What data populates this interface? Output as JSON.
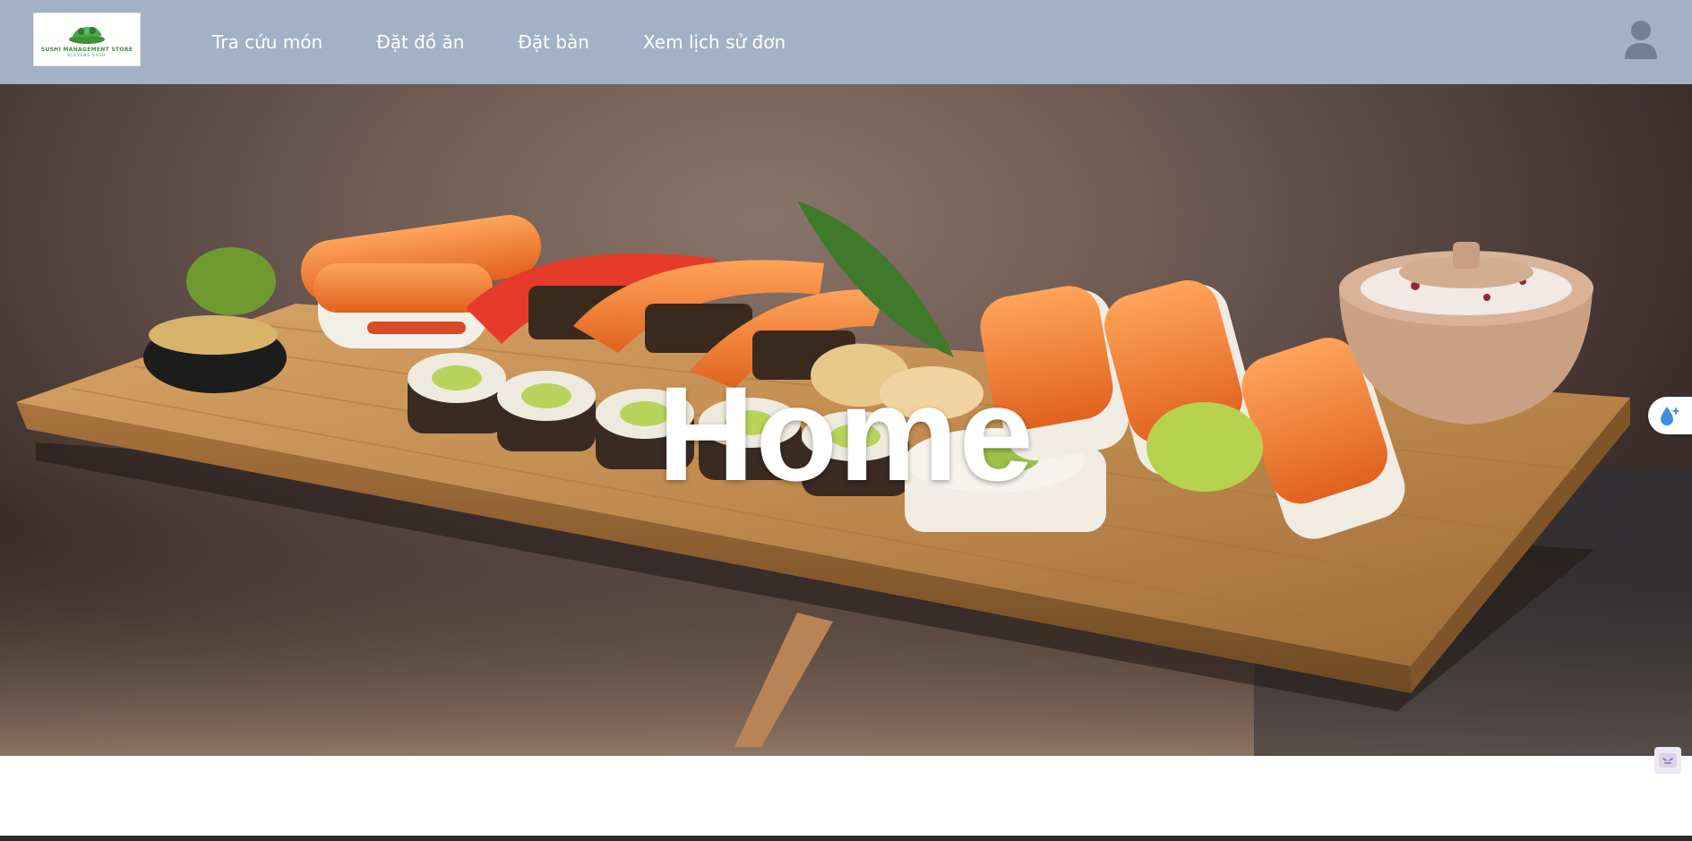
{
  "logo": {
    "text": "SUSHI MANAGEMENT STORE",
    "subtext": "ELEVENS SUSH",
    "icon": "sushi-logo-icon"
  },
  "nav": {
    "items": [
      {
        "label": "Tra cứu món"
      },
      {
        "label": "Đặt đồ ăn"
      },
      {
        "label": "Đặt bàn"
      },
      {
        "label": "Xem lịch sử đơn"
      }
    ],
    "user_icon": "user-icon"
  },
  "hero": {
    "title": "Home",
    "image": "sushi-platter-image"
  },
  "widgets": {
    "side": "water-drop-sparkle-icon",
    "corner": "assistant-icon"
  },
  "colors": {
    "navbar": "#a2b1c5",
    "nav_text": "#ffffff",
    "hero_title": "#ffffff"
  }
}
